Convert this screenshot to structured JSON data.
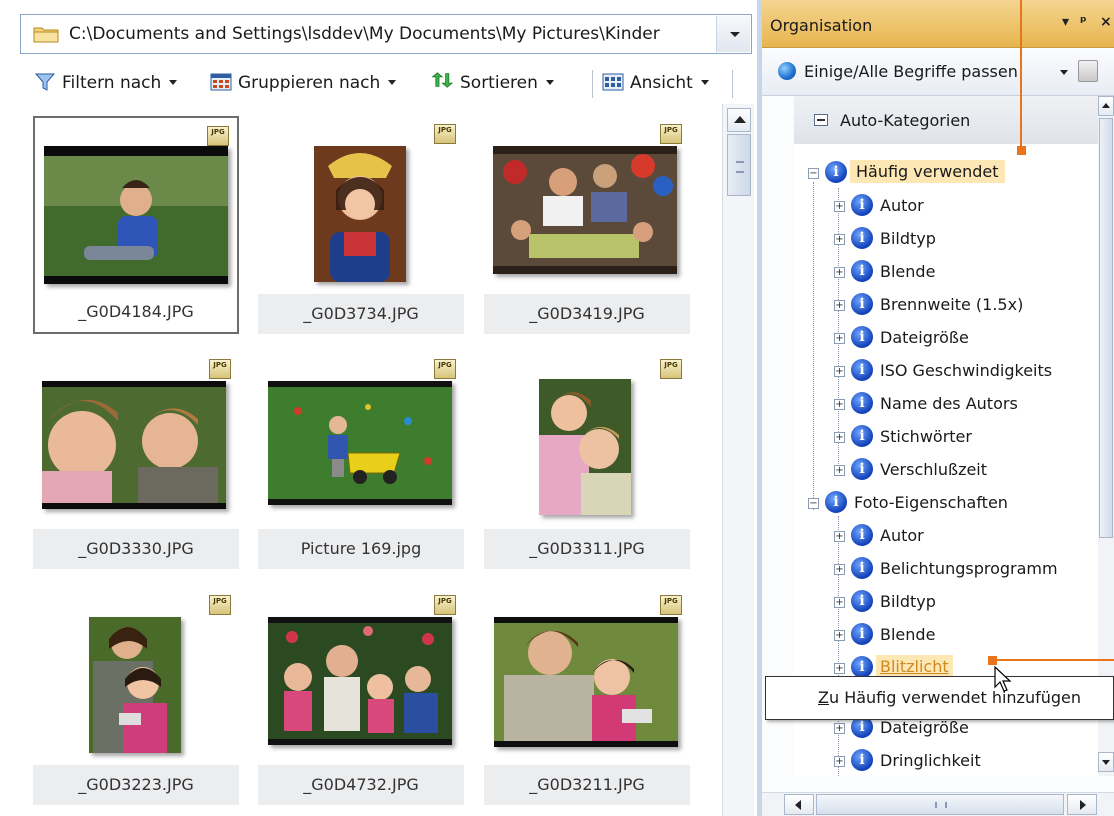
{
  "explorer": {
    "path": "C:\\Documents and Settings\\lsddev\\My Documents\\My Pictures\\Kinder",
    "toolbar": {
      "filter": "Filtern nach",
      "group": "Gruppieren nach",
      "sort": "Sortieren",
      "view": "Ansicht"
    },
    "badge": "JPG",
    "thumbnails": [
      {
        "caption": "_G0D4184.JPG"
      },
      {
        "caption": "_G0D3734.JPG"
      },
      {
        "caption": "_G0D3419.JPG"
      },
      {
        "caption": "_G0D3330.JPG"
      },
      {
        "caption": "Picture 169.jpg"
      },
      {
        "caption": "_G0D3311.JPG"
      },
      {
        "caption": "_G0D3223.JPG"
      },
      {
        "caption": "_G0D4732.JPG"
      },
      {
        "caption": "_G0D3211.JPG"
      }
    ]
  },
  "organisation": {
    "title": "Organisation",
    "header_buttons": [
      "▾",
      "ᵖ",
      "×"
    ],
    "match_mode": "Einige/Alle Begriffe passen",
    "section": "Auto-Kategorien",
    "tree": [
      {
        "label": "Häufig verwendet",
        "level": 0,
        "expanded": true,
        "highlight": true
      },
      {
        "label": "Autor",
        "level": 1
      },
      {
        "label": "Bildtyp",
        "level": 1
      },
      {
        "label": "Blende",
        "level": 1
      },
      {
        "label": "Brennweite (1.5x)",
        "level": 1
      },
      {
        "label": "Dateigröße",
        "level": 1
      },
      {
        "label": "ISO Geschwindigkeits",
        "level": 1
      },
      {
        "label": "Name des Autors",
        "level": 1
      },
      {
        "label": "Stichwörter",
        "level": 1
      },
      {
        "label": "Verschlußzeit",
        "level": 1
      },
      {
        "label": "Foto-Eigenschaften",
        "level": 0,
        "expanded": true
      },
      {
        "label": "Autor",
        "level": 1
      },
      {
        "label": "Belichtungsprogramm",
        "level": 1
      },
      {
        "label": "Bildtyp",
        "level": 1
      },
      {
        "label": "Blende",
        "level": 1
      },
      {
        "label": "Blitzlicht",
        "level": 1,
        "hovered": true
      },
      {
        "label": "Dateigröße",
        "level": 1
      },
      {
        "label": "Dateigröße",
        "level": 1
      },
      {
        "label": "Dringlichkeit",
        "level": 1
      }
    ]
  },
  "tooltip": {
    "text": "Zu Häufig verwendet hinzufügen",
    "accel": "Z"
  },
  "colors": {
    "accent_orange": "#e8741c",
    "header_gold": "#e7b54e",
    "highlight": "#fde7b5",
    "link": "#cf8a1e"
  }
}
